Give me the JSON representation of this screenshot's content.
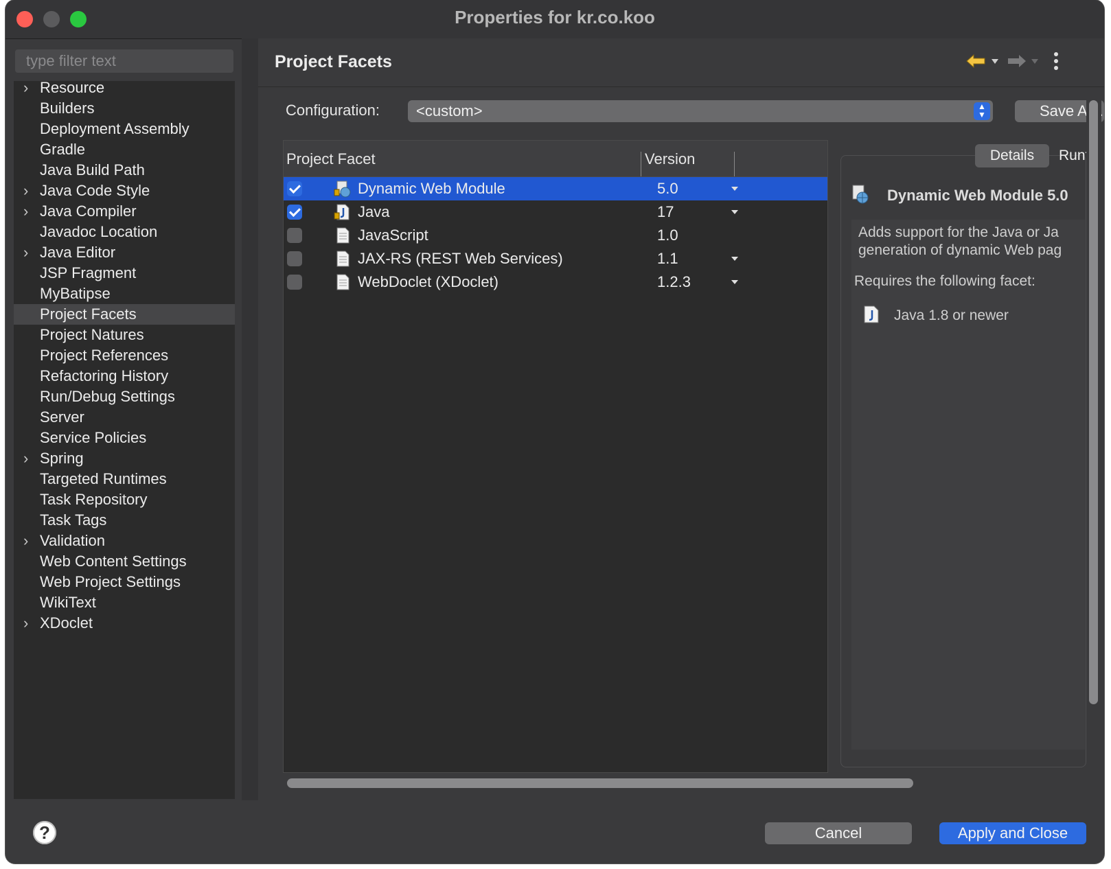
{
  "window": {
    "title": "Properties for kr.co.koo"
  },
  "sidebar": {
    "filter_placeholder": "type filter text",
    "selected": "Project Facets",
    "items": [
      {
        "label": "Resource",
        "expandable": true
      },
      {
        "label": "Builders",
        "expandable": false
      },
      {
        "label": "Deployment Assembly",
        "expandable": false
      },
      {
        "label": "Gradle",
        "expandable": false
      },
      {
        "label": "Java Build Path",
        "expandable": false
      },
      {
        "label": "Java Code Style",
        "expandable": true
      },
      {
        "label": "Java Compiler",
        "expandable": true
      },
      {
        "label": "Javadoc Location",
        "expandable": false
      },
      {
        "label": "Java Editor",
        "expandable": true
      },
      {
        "label": "JSP Fragment",
        "expandable": false
      },
      {
        "label": "MyBatipse",
        "expandable": false
      },
      {
        "label": "Project Facets",
        "expandable": false
      },
      {
        "label": "Project Natures",
        "expandable": false
      },
      {
        "label": "Project References",
        "expandable": false
      },
      {
        "label": "Refactoring History",
        "expandable": false
      },
      {
        "label": "Run/Debug Settings",
        "expandable": false
      },
      {
        "label": "Server",
        "expandable": false
      },
      {
        "label": "Service Policies",
        "expandable": false
      },
      {
        "label": "Spring",
        "expandable": true
      },
      {
        "label": "Targeted Runtimes",
        "expandable": false
      },
      {
        "label": "Task Repository",
        "expandable": false
      },
      {
        "label": "Task Tags",
        "expandable": false
      },
      {
        "label": "Validation",
        "expandable": true
      },
      {
        "label": "Web Content Settings",
        "expandable": false
      },
      {
        "label": "Web Project Settings",
        "expandable": false
      },
      {
        "label": "WikiText",
        "expandable": false
      },
      {
        "label": "XDoclet",
        "expandable": true
      }
    ]
  },
  "page": {
    "title": "Project Facets",
    "configuration_label": "Configuration:",
    "configuration_value": "<custom>",
    "save_as_label": "Save As..."
  },
  "facet_table": {
    "headers": [
      "Project Facet",
      "Version"
    ],
    "rows": [
      {
        "name": "Dynamic Web Module",
        "version": "5.0",
        "checked": true,
        "selected": true,
        "has_dropdown": true,
        "icon": "web-module-icon"
      },
      {
        "name": "Java",
        "version": "17",
        "checked": true,
        "selected": false,
        "has_dropdown": true,
        "icon": "java-icon"
      },
      {
        "name": "JavaScript",
        "version": "1.0",
        "checked": false,
        "selected": false,
        "has_dropdown": false,
        "icon": "file-icon"
      },
      {
        "name": "JAX-RS (REST Web Services)",
        "version": "1.1",
        "checked": false,
        "selected": false,
        "has_dropdown": true,
        "icon": "file-icon"
      },
      {
        "name": "WebDoclet (XDoclet)",
        "version": "1.2.3",
        "checked": false,
        "selected": false,
        "has_dropdown": true,
        "icon": "file-icon"
      }
    ]
  },
  "details": {
    "tabs": [
      "Details",
      "Runtimes"
    ],
    "title": "Dynamic Web Module 5.0",
    "description_line1": "Adds support for the Java or Ja",
    "description_line2": "generation of dynamic Web pag",
    "requires_label": "Requires the following facet:",
    "requires_item": "Java 1.8 or newer"
  },
  "footer": {
    "help": "?",
    "cancel_label": "Cancel",
    "apply_label": "Apply and Close"
  },
  "colors": {
    "accent": "#2d6be0",
    "selection": "#2158d1",
    "close": "#fe5f57",
    "maximize": "#2ac840"
  }
}
